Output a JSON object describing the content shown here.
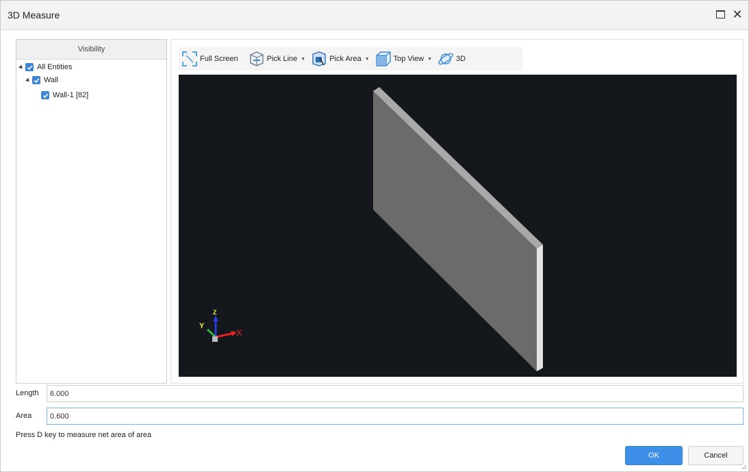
{
  "window": {
    "title": "3D Measure"
  },
  "tree": {
    "header": "Visibility",
    "nodes": [
      {
        "label": "All Entities"
      },
      {
        "label": "Wall"
      },
      {
        "label": "Wall-1 [82]"
      }
    ]
  },
  "toolbar": {
    "full_screen": "Full Screen",
    "pick_line": "Pick Line",
    "pick_area": "Pick Area",
    "top_view": "Top View",
    "view_3d": "3D"
  },
  "axes": {
    "y": "Y",
    "z": "Z",
    "x": "X"
  },
  "fields": {
    "length_label": "Length",
    "length_value": "6.000",
    "area_label": "Area",
    "area_value": "0.600"
  },
  "hint": "Press D key to measure net area of area",
  "buttons": {
    "ok": "OK",
    "cancel": "Cancel"
  },
  "colors": {
    "accent": "#3d8fe8",
    "checkbox": "#3d87d6",
    "viewport_bg": "#14171b"
  }
}
